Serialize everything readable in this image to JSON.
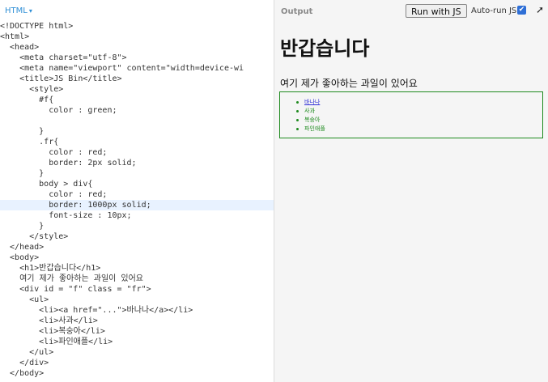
{
  "editor": {
    "label": "HTML",
    "lines": [
      "<!DOCTYPE html>",
      "<html>",
      "  <head>",
      "    <meta charset=\"utf-8\">",
      "    <meta name=\"viewport\" content=\"width=device-wi",
      "    <title>JS Bin</title>",
      "      <style>",
      "        #f{",
      "          color : green;",
      "",
      "        }",
      "        .fr{",
      "          color : red;",
      "          border: 2px solid;",
      "        }",
      "        body > div{",
      "          color : red;",
      "          border: 1000px solid;",
      "          font-size : 10px;",
      "        }",
      "      </style>",
      "  </head>",
      "  <body>",
      "    <h1>반갑습니다</h1>",
      "    여기 제가 좋아하는 과일이 있어요",
      "    <div id = \"f\" class = \"fr\">",
      "      <ul>",
      "        <li><a href=\"...\">바나나</a></li>",
      "        <li>사과</li>",
      "        <li>복숭아</li>",
      "        <li>파인애플</li>",
      "      </ul>",
      "    </div>",
      "  </body>"
    ]
  },
  "output": {
    "label": "Output",
    "run_button": "Run with JS",
    "autorun_label": "Auto-run JS",
    "autorun_checked": true,
    "popout_icon": "external-link-icon",
    "heading": "반갑습니다",
    "text": "여기 제가 좋아하는 과일이 있어요",
    "items": [
      {
        "label": "바나나",
        "link": true
      },
      {
        "label": "사과",
        "link": false
      },
      {
        "label": "복숭아",
        "link": false
      },
      {
        "label": "파인애플",
        "link": false
      }
    ]
  },
  "colors": {
    "accent": "#2f8fd6",
    "green": "#1e8a1e",
    "link": "#2f2fd6"
  }
}
